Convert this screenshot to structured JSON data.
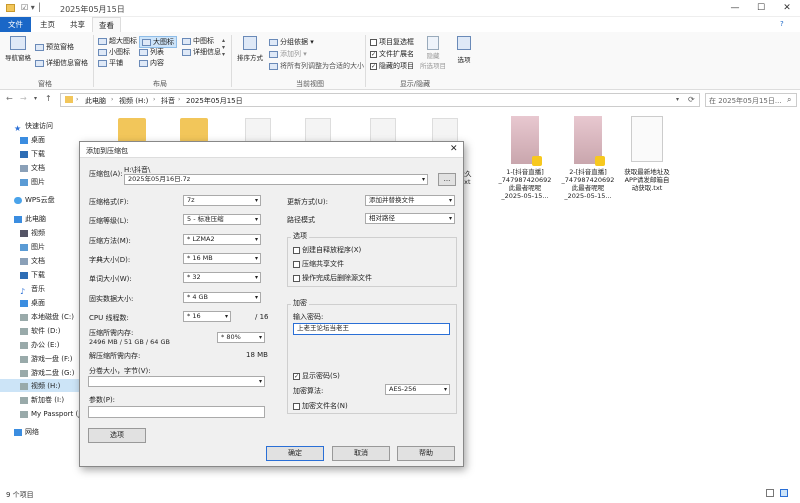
{
  "window": {
    "title": "2025年05月15日",
    "min": "—",
    "max": "☐",
    "close": "✕"
  },
  "menu_tabs": [
    "文件",
    "主页",
    "共享",
    "查看"
  ],
  "ribbon": {
    "pane": {
      "nav_pane": "导航窗格",
      "preview_pane": "预览窗格",
      "details_pane": "详细信息窗格",
      "label": "窗格"
    },
    "layout": {
      "items": [
        "超大图标",
        "大图标",
        "中图标",
        "小图标",
        "列表",
        "详细信息",
        "平铺",
        "内容"
      ],
      "label": "布局"
    },
    "current_view": {
      "sort": "排序方式",
      "group": "分组依据",
      "add_col": "添加列",
      "fit_cols": "将所有列调整为合适的大小",
      "label": "当前视图"
    },
    "show_hide": {
      "item_checkboxes": "项目复选框",
      "file_ext": "文件扩展名",
      "hidden_items": "隐藏的项目",
      "hide_selected": "隐藏",
      "hide_selected2": "所选项目",
      "options": "选项",
      "label": "显示/隐藏"
    }
  },
  "address": {
    "path": [
      "此电脑",
      "视频 (H:)",
      "抖音",
      "2025年05月15日"
    ],
    "search_placeholder": "在 2025年05月15日..."
  },
  "sidebar": {
    "items": [
      "快速访问",
      "桌面",
      "下载",
      "文档",
      "图片",
      "WPS云盘",
      "此电脑",
      "视频",
      "图片",
      "文档",
      "下载",
      "音乐",
      "桌面",
      "本地磁盘 (C:)",
      "软件 (D:)",
      "办公 (E:)",
      "游戏一盘 (F:)",
      "游戏二盘 (G:)",
      "视频 (H:)",
      "新加卷 (I:)",
      "My Passport (J:)",
      "网络"
    ]
  },
  "files": [
    {
      "name": "永久\n.txt"
    },
    {
      "name": "1-[抖音直播]\n_747987420692\n此最者呢呢\n_2025-05-15..."
    },
    {
      "name": "2-[抖音直播]\n_747987420692\n此最者呢呢\n_2025-05-15..."
    },
    {
      "name": "获取最新地址及\nAPP请发邮箱自\n动获取.txt"
    }
  ],
  "status": {
    "count": "9 个项目"
  },
  "dialog": {
    "title": "添加到压缩包",
    "archive_label": "压缩包(A):",
    "archive_dir": "H:\\抖音\\",
    "archive_name": "2025年05月16日.7z",
    "browse": "...",
    "format_label": "压缩格式(F):",
    "format": "7z",
    "level_label": "压缩等级(L):",
    "level": "5 - 标准压缩",
    "method_label": "压缩方法(M):",
    "method": "* LZMA2",
    "dict_label": "字典大小(D):",
    "dict": "* 16 MB",
    "word_label": "单词大小(W):",
    "word": "* 32",
    "solid_label": "固实数据大小:",
    "solid": "* 4 GB",
    "threads_label": "CPU 线程数:",
    "threads": "* 16",
    "threads_max": "/ 16",
    "mem_label": "压缩所需内存:",
    "mem_value": "2496 MB / 51 GB / 64 GB",
    "mem_pct": "* 80%",
    "demem_label": "解压缩所需内存:",
    "demem_value": "18 MB",
    "split_label": "分卷大小，字节(V):",
    "params_label": "参数(P):",
    "options_btn": "选项",
    "update_label": "更新方式(U):",
    "update": "添加并替换文件",
    "path_label": "路径模式",
    "path": "相对路径",
    "opts_group": "选项",
    "opt1": "创建自释放程序(X)",
    "opt2": "压缩共享文件",
    "opt3": "操作完成后删除源文件",
    "enc_group": "加密",
    "pwd_label": "输入密码:",
    "pwd": "上老王论坛当老王",
    "show_pwd": "显示密码(S)",
    "enc_method_label": "加密算法:",
    "enc_method": "AES-256",
    "enc_names": "加密文件名(N)",
    "ok": "确定",
    "cancel": "取消",
    "help": "帮助"
  }
}
